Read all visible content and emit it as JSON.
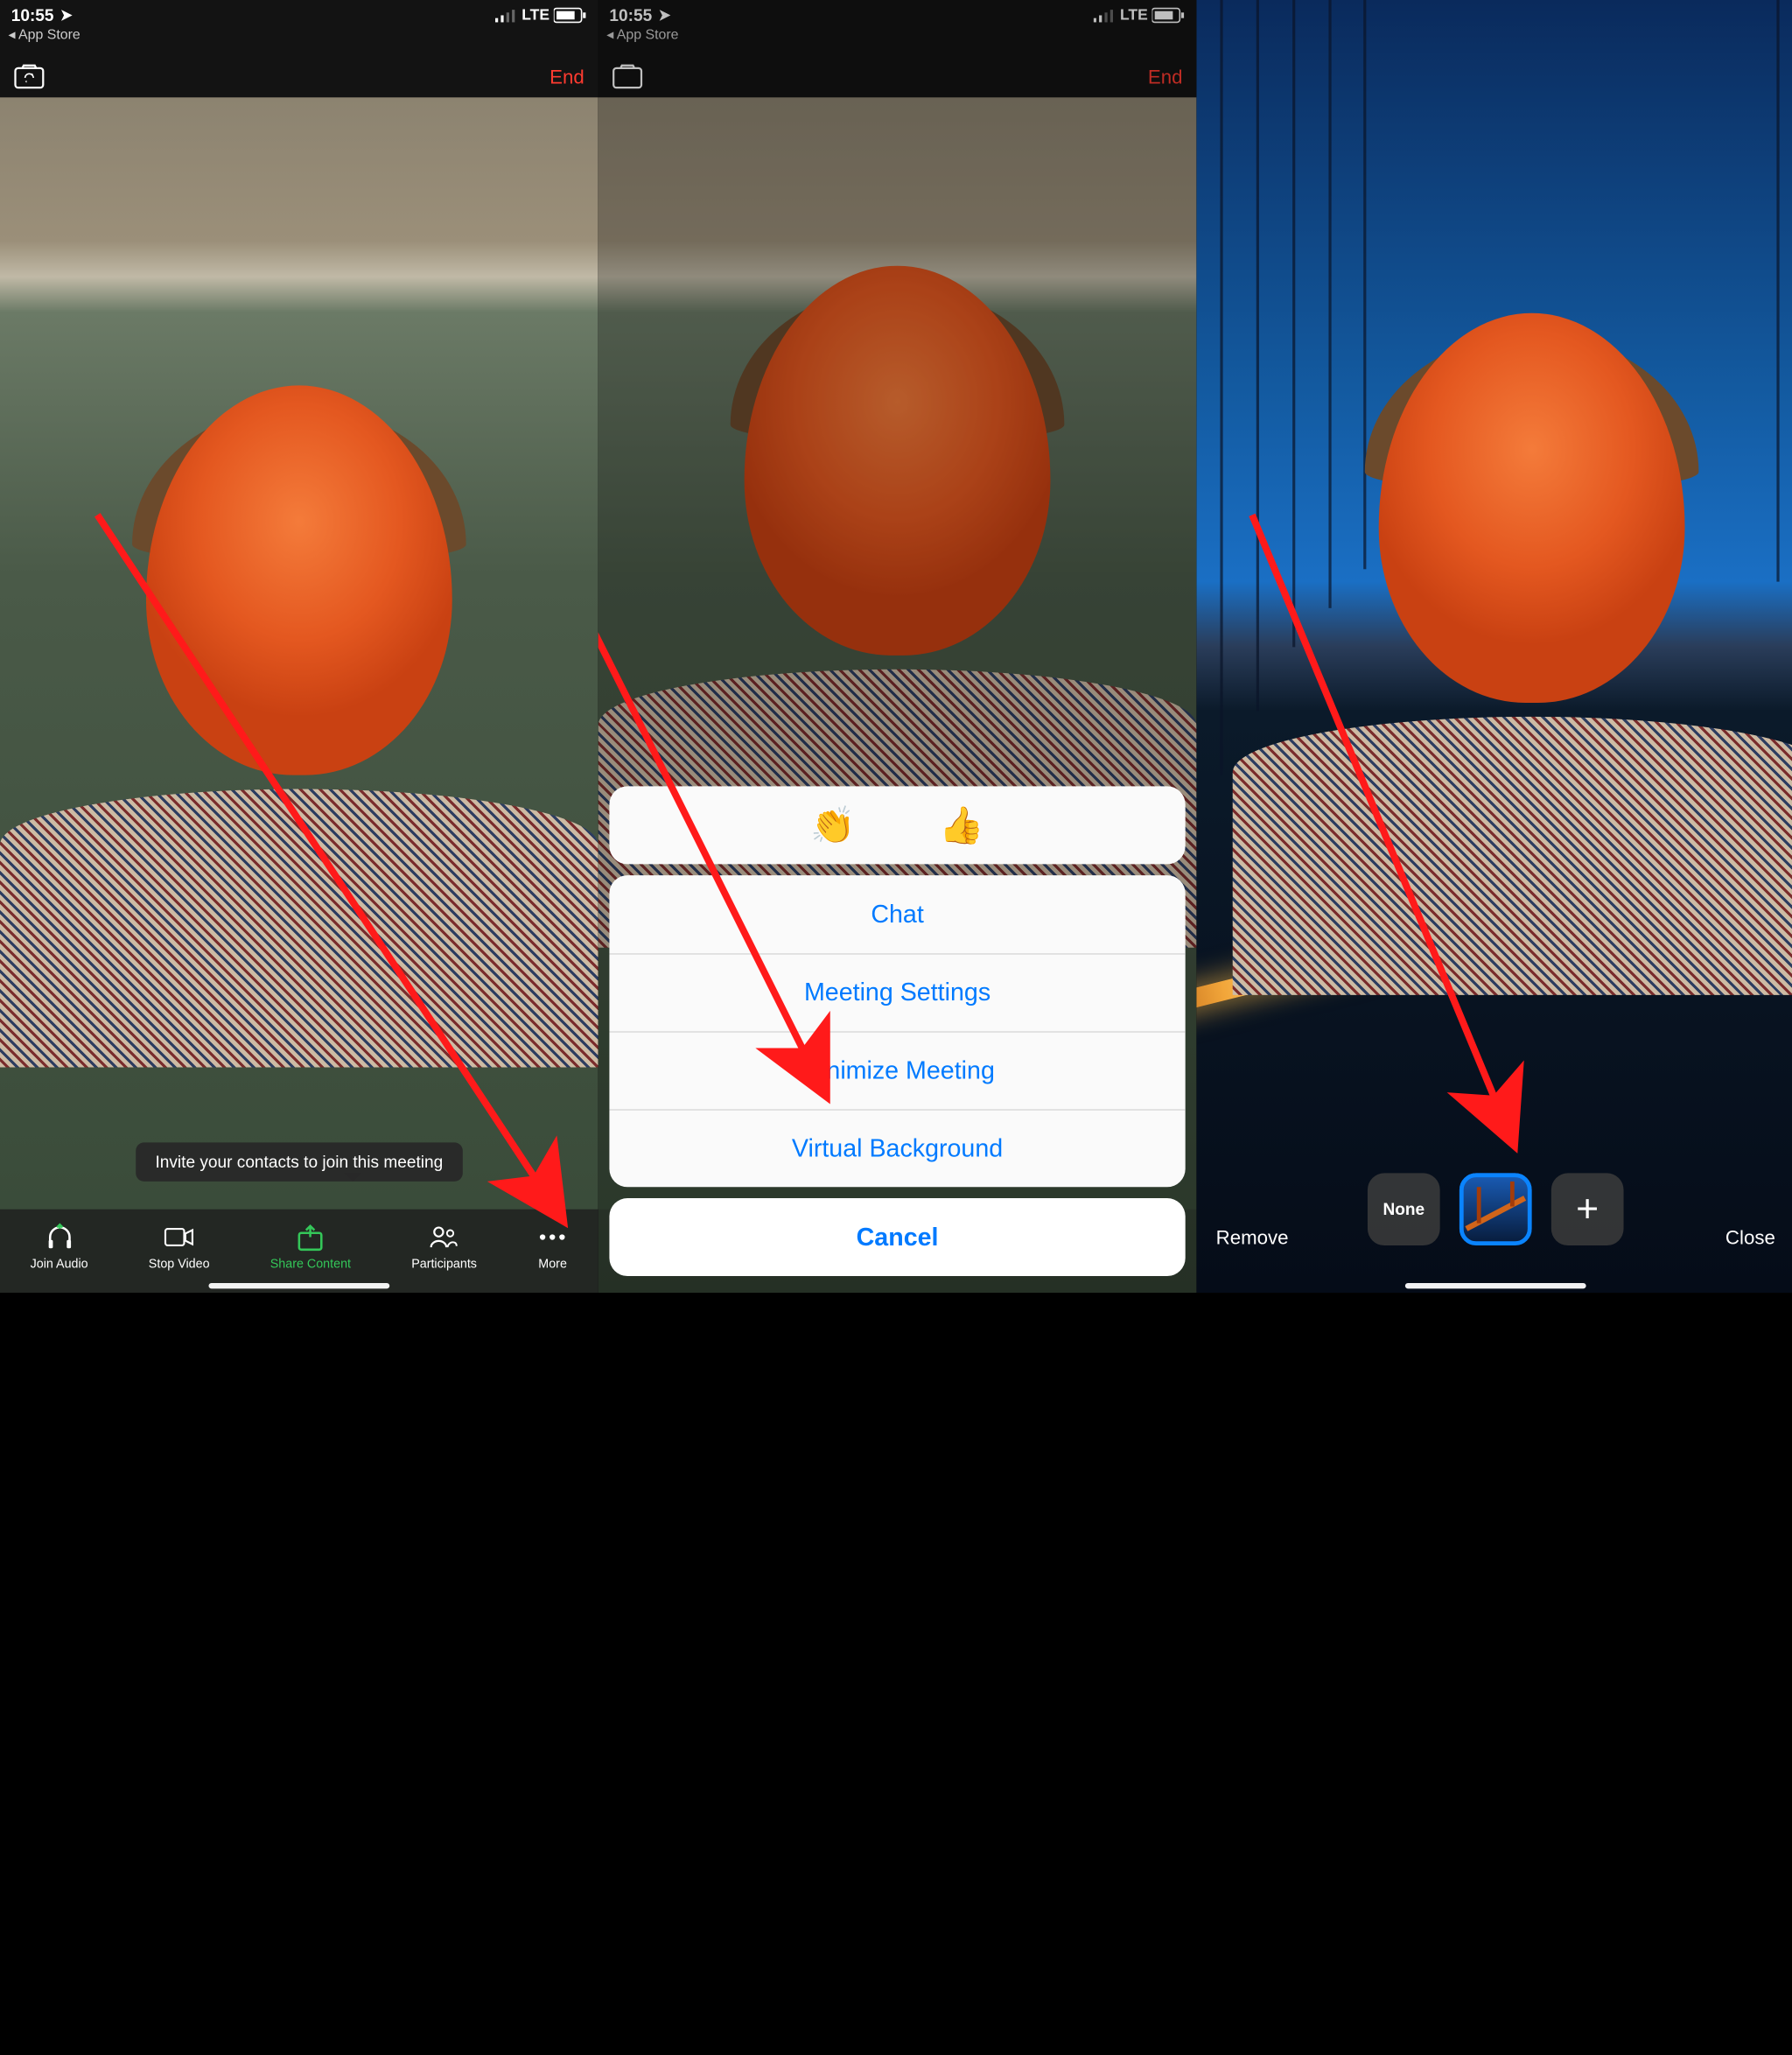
{
  "status": {
    "time": "10:55",
    "network": "LTE",
    "back_app": "◂ App Store"
  },
  "topbar": {
    "end": "End"
  },
  "callout": {
    "text": "Invite your contacts to join this meeting"
  },
  "toolbar": {
    "items": [
      {
        "id": "join-audio",
        "label": "Join Audio"
      },
      {
        "id": "stop-video",
        "label": "Stop Video"
      },
      {
        "id": "share-content",
        "label": "Share Content"
      },
      {
        "id": "participants",
        "label": "Participants"
      },
      {
        "id": "more",
        "label": "More"
      }
    ]
  },
  "sheet": {
    "emoji_clap": "👏",
    "emoji_thumb": "👍",
    "rows": [
      {
        "id": "chat",
        "label": "Chat"
      },
      {
        "id": "meeting-settings",
        "label": "Meeting Settings"
      },
      {
        "id": "minimize-meeting",
        "label": "Minimize Meeting"
      },
      {
        "id": "virtual-background",
        "label": "Virtual Background"
      }
    ],
    "cancel": "Cancel"
  },
  "vb": {
    "remove": "Remove",
    "close": "Close",
    "none": "None"
  },
  "colors": {
    "accent": "#007aff",
    "destructive": "#ff3b30",
    "share": "#34c759"
  }
}
